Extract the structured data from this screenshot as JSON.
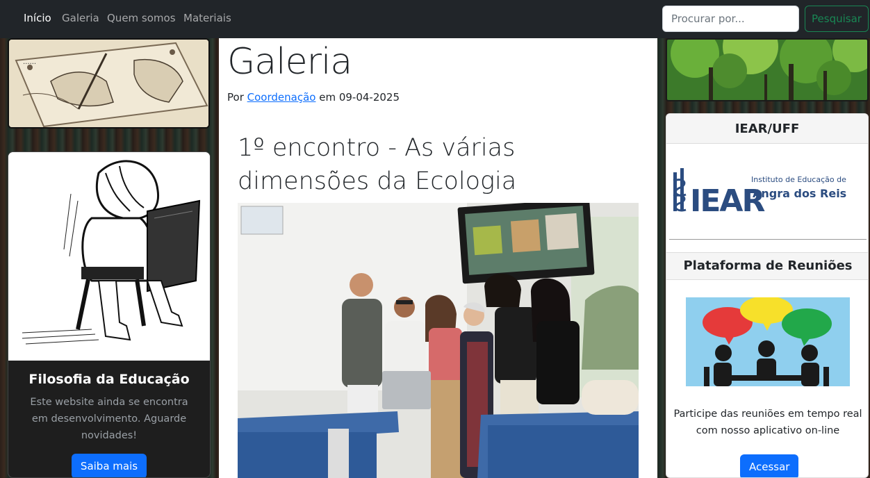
{
  "nav": {
    "items": [
      {
        "label": "Início",
        "active": true
      },
      {
        "label": "Galeria",
        "active": false
      },
      {
        "label": "Quem somos",
        "active": false
      },
      {
        "label": "Materiais",
        "active": false
      }
    ],
    "search_placeholder": "Procurar por...",
    "search_button": "Pesquisar"
  },
  "left_card": {
    "title": "Filosofia da Educação",
    "text": "Este website ainda se encontra em desenvolvimento. Aguarde novidades!",
    "button": "Saiba mais"
  },
  "main": {
    "page_title": "Galeria",
    "byline_prefix": "Por",
    "author": "Coordenação",
    "byline_mid": "em",
    "date": "09-04-2025",
    "post_title": "1º encontro - As várias dimensões da Ecologia"
  },
  "right": {
    "card1_header": "IEAR/UFF",
    "logo_line1": "Instituto de Educação de",
    "logo_line2": "Angra dos Reis",
    "logo_mark": "IEAR",
    "card2_header": "Plataforma de Reuniões",
    "meeting_text": "Participe das reuniões em tempo real com nosso aplicativo on-line",
    "meeting_button": "Acessar"
  },
  "colors": {
    "navbar_bg": "#212529",
    "primary": "#0d6efd",
    "success": "#198754",
    "logo_blue": "#2b4c80"
  }
}
